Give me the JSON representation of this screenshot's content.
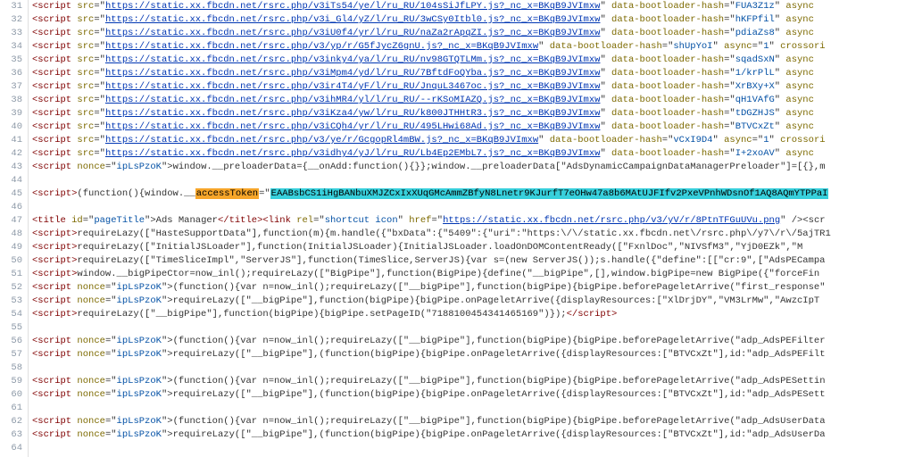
{
  "editor": {
    "first_line_number": 31,
    "lines": [
      {
        "n": 31,
        "type": "ext-script",
        "url": "https://static.xx.fbcdn.net/rsrc.php/v3iTs54/ye/l/ru_RU/104sSiJfLPY.js?_nc_x=BKqB9JVImxw",
        "hash": "FUA3Z1z"
      },
      {
        "n": 32,
        "type": "ext-script",
        "url": "https://static.xx.fbcdn.net/rsrc.php/v3i_Gl4/yZ/l/ru_RU/3wCSy0Itbl0.js?_nc_x=BKqB9JVImxw",
        "hash": "hKFPfil"
      },
      {
        "n": 33,
        "type": "ext-script",
        "url": "https://static.xx.fbcdn.net/rsrc.php/v3iU0f4/yr/l/ru_RU/naZa2rApqZI.js?_nc_x=BKqB9JVImxw",
        "hash": "pdiaZs8"
      },
      {
        "n": 34,
        "type": "ext-script-short",
        "url": "https://static.xx.fbcdn.net/rsrc.php/v3/yp/r/G5fJycZ6gnU.js?_nc_x=BKqB9JVImxw",
        "hash": "shUpYoI",
        "async": "1",
        "tail": "crossori"
      },
      {
        "n": 35,
        "type": "ext-script",
        "url": "https://static.xx.fbcdn.net/rsrc.php/v3inky4/ya/l/ru_RU/nv98GTQTLMm.js?_nc_x=BKqB9JVImxw",
        "hash": "sqadSxN"
      },
      {
        "n": 36,
        "type": "ext-script",
        "url": "https://static.xx.fbcdn.net/rsrc.php/v3iMpm4/yd/l/ru_RU/7BftdFoQYba.js?_nc_x=BKqB9JVImxw",
        "hash": "1/krPlL"
      },
      {
        "n": 37,
        "type": "ext-script",
        "url": "https://static.xx.fbcdn.net/rsrc.php/v3ir4T4/yF/l/ru_RU/JnquL3467oc.js?_nc_x=BKqB9JVImxw",
        "hash": "XrBXy+X"
      },
      {
        "n": 38,
        "type": "ext-script",
        "url": "https://static.xx.fbcdn.net/rsrc.php/v3ihMR4/yl/l/ru_RU/--rKSoMIAZQ.js?_nc_x=BKqB9JVImxw",
        "hash": "qH1VAfG"
      },
      {
        "n": 39,
        "type": "ext-script",
        "url": "https://static.xx.fbcdn.net/rsrc.php/v3iKza4/yw/l/ru_RU/k800JTHHtR3.js?_nc_x=BKqB9JVImxw",
        "hash": "tDGZHJS"
      },
      {
        "n": 40,
        "type": "ext-script",
        "url": "https://static.xx.fbcdn.net/rsrc.php/v3iCQh4/yr/l/ru_RU/495LHwi68Ad.js?_nc_x=BKqB9JVImxw",
        "hash": "BTVCxZt"
      },
      {
        "n": 41,
        "type": "ext-script-short",
        "url": "https://static.xx.fbcdn.net/rsrc.php/v3/ye/r/GcgopRl4mBW.js?_nc_x=BKqB9JVImxw",
        "hash": "vCxI9D4",
        "async": "1",
        "tail": "crossori"
      },
      {
        "n": 42,
        "type": "ext-script",
        "url": "https://static.xx.fbcdn.net/rsrc.php/v3idhy4/yJ/l/ru_RU/Lb4Ep2EMbL7.js?_nc_x=BKqB9JVImxw",
        "hash": "I+2xoAV"
      },
      {
        "n": 43,
        "type": "inline",
        "nonce": "ipLsPzoK",
        "code": "window.__preloaderData={__onAdd:function(){}};window.__preloaderData[\"AdsDynamicCampaignDataManagerPreloader\"]=[{},m"
      },
      {
        "n": 44,
        "type": "blank"
      },
      {
        "n": 45,
        "type": "access-token",
        "prefix": "(function(){window.__",
        "highlight_key": "accessToken",
        "highlight_val": "EAABsbCS1iHgBANbuXMJZCxIxXUqGMcAmmZBfyN8Lnetr9KJurfT7eOHw47a8b6MAtUJFIfv2PxeVPnhWDsnOf1AQ8AQmYTPPaI"
      },
      {
        "n": 46,
        "type": "blank"
      },
      {
        "n": 47,
        "type": "title-line",
        "id": "pageTitle",
        "title_text": "Ads Manager",
        "link_rel": "shortcut icon",
        "link_url": "https://static.xx.fbcdn.net/rsrc.php/v3/yV/r/8PtnTFGuUVu.png",
        "tail": "/><scr"
      },
      {
        "n": 48,
        "type": "inline-plain",
        "code": "requireLazy([\"HasteSupportData\"],function(m){m.handle({\"bxData\":{\"5409\":{\"uri\":\"https:\\/\\/static.xx.fbcdn.net\\/rsrc.php\\/y7\\/r\\/5ajTR1"
      },
      {
        "n": 49,
        "type": "inline-plain",
        "code": "requireLazy([\"InitialJSLoader\"],function(InitialJSLoader){InitialJSLoader.loadOnDOMContentReady([\"FxnlDoc\",\"NIVSfM3\",\"YjD0EZk\",\"M"
      },
      {
        "n": 50,
        "type": "inline-plain",
        "code": "requireLazy([\"TimeSliceImpl\",\"ServerJS\"],function(TimeSlice,ServerJS){var s=(new ServerJS());s.handle({\"define\":[[\"cr:9\",[\"AdsPECampa"
      },
      {
        "n": 51,
        "type": "inline-plain",
        "code": "window.__bigPipeCtor=now_inl();requireLazy([\"BigPipe\"],function(BigPipe){define(\"__bigPipe\",[],window.bigPipe=new BigPipe({\"forceFin"
      },
      {
        "n": 52,
        "type": "inline",
        "nonce": "ipLsPzoK",
        "code": "(function(){var n=now_inl();requireLazy([\"__bigPipe\"],function(bigPipe){bigPipe.beforePageletArrive(\"first_response\""
      },
      {
        "n": 53,
        "type": "inline",
        "nonce": "ipLsPzoK",
        "code": "requireLazy([\"__bigPipe\"],function(bigPipe){bigPipe.onPageletArrive({displayResources:[\"XlDrjDY\",\"VM3LrMw\",\"AwzcIpT"
      },
      {
        "n": 54,
        "type": "inline-close",
        "code": "requireLazy([\"__bigPipe\"],function(bigPipe){bigPipe.setPageID(\"7188100454341465169\")});"
      },
      {
        "n": 55,
        "type": "blank"
      },
      {
        "n": 56,
        "type": "inline",
        "nonce": "ipLsPzoK",
        "code": "(function(){var n=now_inl();requireLazy([\"__bigPipe\"],function(bigPipe){bigPipe.beforePageletArrive(\"adp_AdsPEFilter"
      },
      {
        "n": 57,
        "type": "inline",
        "nonce": "ipLsPzoK",
        "code": "requireLazy([\"__bigPipe\"],(function(bigPipe){bigPipe.onPageletArrive({displayResources:[\"BTVCxZt\"],id:\"adp_AdsPEFilt"
      },
      {
        "n": 58,
        "type": "blank"
      },
      {
        "n": 59,
        "type": "inline",
        "nonce": "ipLsPzoK",
        "code": "(function(){var n=now_inl();requireLazy([\"__bigPipe\"],function(bigPipe){bigPipe.beforePageletArrive(\"adp_AdsPESettin"
      },
      {
        "n": 60,
        "type": "inline",
        "nonce": "ipLsPzoK",
        "code": "requireLazy([\"__bigPipe\"],(function(bigPipe){bigPipe.onPageletArrive({displayResources:[\"BTVCxZt\"],id:\"adp_AdsPESett"
      },
      {
        "n": 61,
        "type": "blank"
      },
      {
        "n": 62,
        "type": "inline",
        "nonce": "ipLsPzoK",
        "code": "(function(){var n=now_inl();requireLazy([\"__bigPipe\"],function(bigPipe){bigPipe.beforePageletArrive(\"adp_AdsUserData"
      },
      {
        "n": 63,
        "type": "inline",
        "nonce": "ipLsPzoK",
        "code": "requireLazy([\"__bigPipe\"],(function(bigPipe){bigPipe.onPageletArrive({displayResources:[\"BTVCxZt\"],id:\"adp_AdsUserDa"
      },
      {
        "n": 64,
        "type": "blank"
      }
    ]
  }
}
